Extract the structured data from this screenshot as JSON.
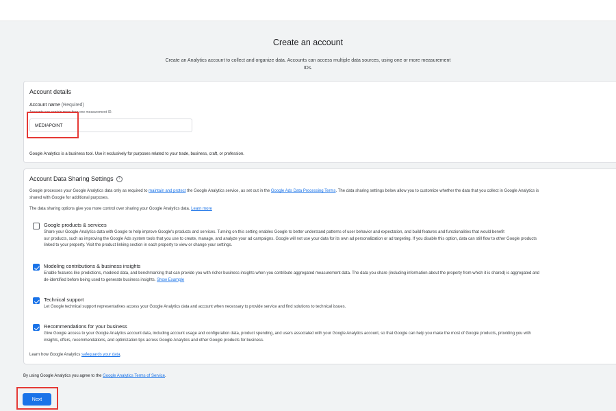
{
  "header": {
    "title": "Create an account",
    "subtitle": "Create an Analytics account to collect and organize data. Accounts can access multiple data sources, using one or more measurement IDs."
  },
  "account_details": {
    "heading": "Account details",
    "name_label": "Account name",
    "required_label": "(Required)",
    "name_help": "Accounts can contain more than one measurement ID.",
    "name_value": "MEDIAPOINT",
    "business_note": "Google Analytics is a business tool. Use it exclusively for purposes related to your trade, business, craft, or profession."
  },
  "sharing": {
    "heading": "Account Data Sharing Settings",
    "intro_1a": "Google processes your Google Analytics data only as required to ",
    "intro_link_1": "maintain and protect",
    "intro_1b": " the Google Analytics service, as set out in the ",
    "intro_link_2": "Google Ads Data Processing Terms",
    "intro_1c": ". The data sharing settings below allow you to customize whether the data that you collect in Google Analytics is",
    "intro_2": "shared with Google for additional purposes.",
    "options_intro": "The data sharing options give you more control over sharing your Google Analytics data. ",
    "options_link": "Learn more",
    "options": [
      {
        "title": "Google products & services",
        "checked": false,
        "lines": [
          "Share your Google Analytics data with Google to help improve Google's products and services. Turning on this setting enables Google to better understand patterns of user behavior and expectation, and build features and functionalities that would benefit",
          "our products, such as improving the Google Ads system tools that you use to create, manage, and analyze your ad campaigns. Google will not use your data for its own ad personalization or ad targeting. If you disable this option, data can still flow to other Google products",
          "linked to your property. Visit the product linking section in each property to view or change your settings."
        ]
      },
      {
        "title": "Modeling contributions & business insights",
        "checked": true,
        "lines": [
          "Enable features like predictions, modeled data, and benchmarking that can provide you with richer business insights when you contribute aggregated measurement data. The data you share (including information about the property from which it is shared) is aggregated and",
          "de-identified before being used to generate business insights. "
        ],
        "link": "Show Example"
      },
      {
        "title": "Technical support",
        "checked": true,
        "lines": [
          "Let Google technical support representatives access your Google Analytics data and account when necessary to provide service and find solutions to technical issues."
        ]
      },
      {
        "title": "Recommendations for your business",
        "checked": true,
        "lines": [
          "Give Google access to your Google Analytics account data, including account usage and configuration data, product spending, and users associated with your Google Analytics account, so that Google can help you make the most of Google products, providing you with",
          "insights, offers, recommendations, and optimization tips across Google Analytics and other Google products for business."
        ]
      }
    ],
    "safeguards_text": "Learn how Google Analytics ",
    "safeguards_link": "safeguards your data",
    "safeguards_end": "."
  },
  "footer": {
    "terms_text": "By using Google Analytics you agree to the ",
    "terms_link": "Google Analytics Terms of Service",
    "terms_end": ".",
    "next_label": "Next"
  },
  "colors": {
    "primary": "#1a73e8",
    "highlight": "#e53935",
    "background": "#f1f3f4"
  }
}
